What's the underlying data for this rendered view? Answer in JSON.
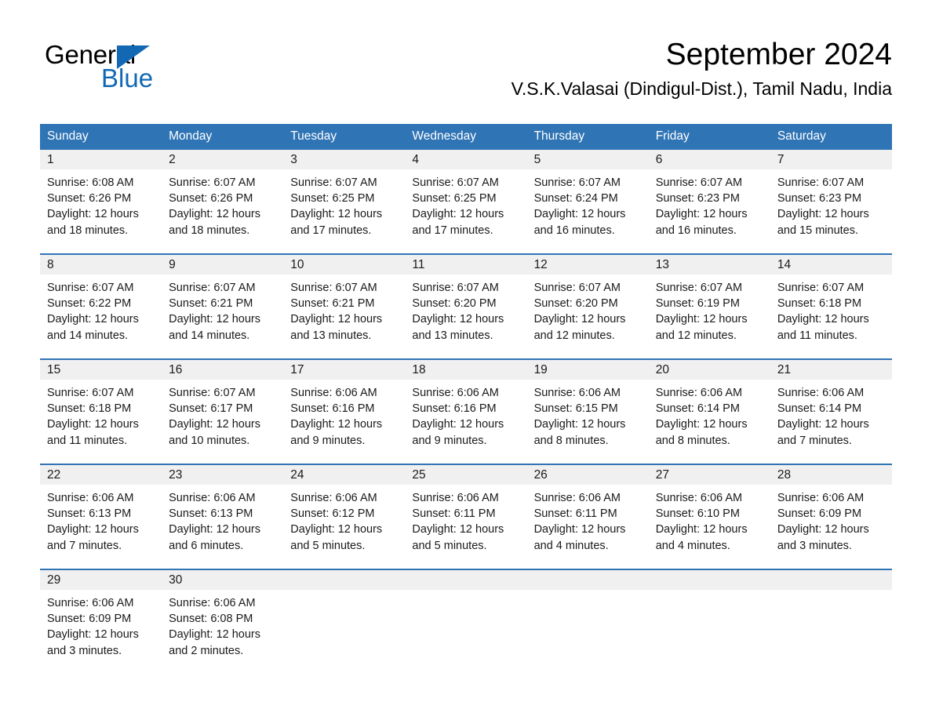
{
  "brand": {
    "name_part1": "General",
    "name_part2": "Blue",
    "triangle_color": "#1268b3",
    "accent_color": "#2f74b5"
  },
  "header": {
    "title": "September 2024",
    "subtitle": "V.S.K.Valasai (Dindigul-Dist.), Tamil Nadu, India"
  },
  "calendar": {
    "weekdays": [
      "Sunday",
      "Monday",
      "Tuesday",
      "Wednesday",
      "Thursday",
      "Friday",
      "Saturday"
    ],
    "weeks": [
      [
        {
          "day": "1",
          "sunrise": "Sunrise: 6:08 AM",
          "sunset": "Sunset: 6:26 PM",
          "daylight1": "Daylight: 12 hours",
          "daylight2": "and 18 minutes."
        },
        {
          "day": "2",
          "sunrise": "Sunrise: 6:07 AM",
          "sunset": "Sunset: 6:26 PM",
          "daylight1": "Daylight: 12 hours",
          "daylight2": "and 18 minutes."
        },
        {
          "day": "3",
          "sunrise": "Sunrise: 6:07 AM",
          "sunset": "Sunset: 6:25 PM",
          "daylight1": "Daylight: 12 hours",
          "daylight2": "and 17 minutes."
        },
        {
          "day": "4",
          "sunrise": "Sunrise: 6:07 AM",
          "sunset": "Sunset: 6:25 PM",
          "daylight1": "Daylight: 12 hours",
          "daylight2": "and 17 minutes."
        },
        {
          "day": "5",
          "sunrise": "Sunrise: 6:07 AM",
          "sunset": "Sunset: 6:24 PM",
          "daylight1": "Daylight: 12 hours",
          "daylight2": "and 16 minutes."
        },
        {
          "day": "6",
          "sunrise": "Sunrise: 6:07 AM",
          "sunset": "Sunset: 6:23 PM",
          "daylight1": "Daylight: 12 hours",
          "daylight2": "and 16 minutes."
        },
        {
          "day": "7",
          "sunrise": "Sunrise: 6:07 AM",
          "sunset": "Sunset: 6:23 PM",
          "daylight1": "Daylight: 12 hours",
          "daylight2": "and 15 minutes."
        }
      ],
      [
        {
          "day": "8",
          "sunrise": "Sunrise: 6:07 AM",
          "sunset": "Sunset: 6:22 PM",
          "daylight1": "Daylight: 12 hours",
          "daylight2": "and 14 minutes."
        },
        {
          "day": "9",
          "sunrise": "Sunrise: 6:07 AM",
          "sunset": "Sunset: 6:21 PM",
          "daylight1": "Daylight: 12 hours",
          "daylight2": "and 14 minutes."
        },
        {
          "day": "10",
          "sunrise": "Sunrise: 6:07 AM",
          "sunset": "Sunset: 6:21 PM",
          "daylight1": "Daylight: 12 hours",
          "daylight2": "and 13 minutes."
        },
        {
          "day": "11",
          "sunrise": "Sunrise: 6:07 AM",
          "sunset": "Sunset: 6:20 PM",
          "daylight1": "Daylight: 12 hours",
          "daylight2": "and 13 minutes."
        },
        {
          "day": "12",
          "sunrise": "Sunrise: 6:07 AM",
          "sunset": "Sunset: 6:20 PM",
          "daylight1": "Daylight: 12 hours",
          "daylight2": "and 12 minutes."
        },
        {
          "day": "13",
          "sunrise": "Sunrise: 6:07 AM",
          "sunset": "Sunset: 6:19 PM",
          "daylight1": "Daylight: 12 hours",
          "daylight2": "and 12 minutes."
        },
        {
          "day": "14",
          "sunrise": "Sunrise: 6:07 AM",
          "sunset": "Sunset: 6:18 PM",
          "daylight1": "Daylight: 12 hours",
          "daylight2": "and 11 minutes."
        }
      ],
      [
        {
          "day": "15",
          "sunrise": "Sunrise: 6:07 AM",
          "sunset": "Sunset: 6:18 PM",
          "daylight1": "Daylight: 12 hours",
          "daylight2": "and 11 minutes."
        },
        {
          "day": "16",
          "sunrise": "Sunrise: 6:07 AM",
          "sunset": "Sunset: 6:17 PM",
          "daylight1": "Daylight: 12 hours",
          "daylight2": "and 10 minutes."
        },
        {
          "day": "17",
          "sunrise": "Sunrise: 6:06 AM",
          "sunset": "Sunset: 6:16 PM",
          "daylight1": "Daylight: 12 hours",
          "daylight2": "and 9 minutes."
        },
        {
          "day": "18",
          "sunrise": "Sunrise: 6:06 AM",
          "sunset": "Sunset: 6:16 PM",
          "daylight1": "Daylight: 12 hours",
          "daylight2": "and 9 minutes."
        },
        {
          "day": "19",
          "sunrise": "Sunrise: 6:06 AM",
          "sunset": "Sunset: 6:15 PM",
          "daylight1": "Daylight: 12 hours",
          "daylight2": "and 8 minutes."
        },
        {
          "day": "20",
          "sunrise": "Sunrise: 6:06 AM",
          "sunset": "Sunset: 6:14 PM",
          "daylight1": "Daylight: 12 hours",
          "daylight2": "and 8 minutes."
        },
        {
          "day": "21",
          "sunrise": "Sunrise: 6:06 AM",
          "sunset": "Sunset: 6:14 PM",
          "daylight1": "Daylight: 12 hours",
          "daylight2": "and 7 minutes."
        }
      ],
      [
        {
          "day": "22",
          "sunrise": "Sunrise: 6:06 AM",
          "sunset": "Sunset: 6:13 PM",
          "daylight1": "Daylight: 12 hours",
          "daylight2": "and 7 minutes."
        },
        {
          "day": "23",
          "sunrise": "Sunrise: 6:06 AM",
          "sunset": "Sunset: 6:13 PM",
          "daylight1": "Daylight: 12 hours",
          "daylight2": "and 6 minutes."
        },
        {
          "day": "24",
          "sunrise": "Sunrise: 6:06 AM",
          "sunset": "Sunset: 6:12 PM",
          "daylight1": "Daylight: 12 hours",
          "daylight2": "and 5 minutes."
        },
        {
          "day": "25",
          "sunrise": "Sunrise: 6:06 AM",
          "sunset": "Sunset: 6:11 PM",
          "daylight1": "Daylight: 12 hours",
          "daylight2": "and 5 minutes."
        },
        {
          "day": "26",
          "sunrise": "Sunrise: 6:06 AM",
          "sunset": "Sunset: 6:11 PM",
          "daylight1": "Daylight: 12 hours",
          "daylight2": "and 4 minutes."
        },
        {
          "day": "27",
          "sunrise": "Sunrise: 6:06 AM",
          "sunset": "Sunset: 6:10 PM",
          "daylight1": "Daylight: 12 hours",
          "daylight2": "and 4 minutes."
        },
        {
          "day": "28",
          "sunrise": "Sunrise: 6:06 AM",
          "sunset": "Sunset: 6:09 PM",
          "daylight1": "Daylight: 12 hours",
          "daylight2": "and 3 minutes."
        }
      ],
      [
        {
          "day": "29",
          "sunrise": "Sunrise: 6:06 AM",
          "sunset": "Sunset: 6:09 PM",
          "daylight1": "Daylight: 12 hours",
          "daylight2": "and 3 minutes."
        },
        {
          "day": "30",
          "sunrise": "Sunrise: 6:06 AM",
          "sunset": "Sunset: 6:08 PM",
          "daylight1": "Daylight: 12 hours",
          "daylight2": "and 2 minutes."
        },
        {
          "day": "",
          "sunrise": "",
          "sunset": "",
          "daylight1": "",
          "daylight2": ""
        },
        {
          "day": "",
          "sunrise": "",
          "sunset": "",
          "daylight1": "",
          "daylight2": ""
        },
        {
          "day": "",
          "sunrise": "",
          "sunset": "",
          "daylight1": "",
          "daylight2": ""
        },
        {
          "day": "",
          "sunrise": "",
          "sunset": "",
          "daylight1": "",
          "daylight2": ""
        },
        {
          "day": "",
          "sunrise": "",
          "sunset": "",
          "daylight1": "",
          "daylight2": ""
        }
      ]
    ]
  }
}
